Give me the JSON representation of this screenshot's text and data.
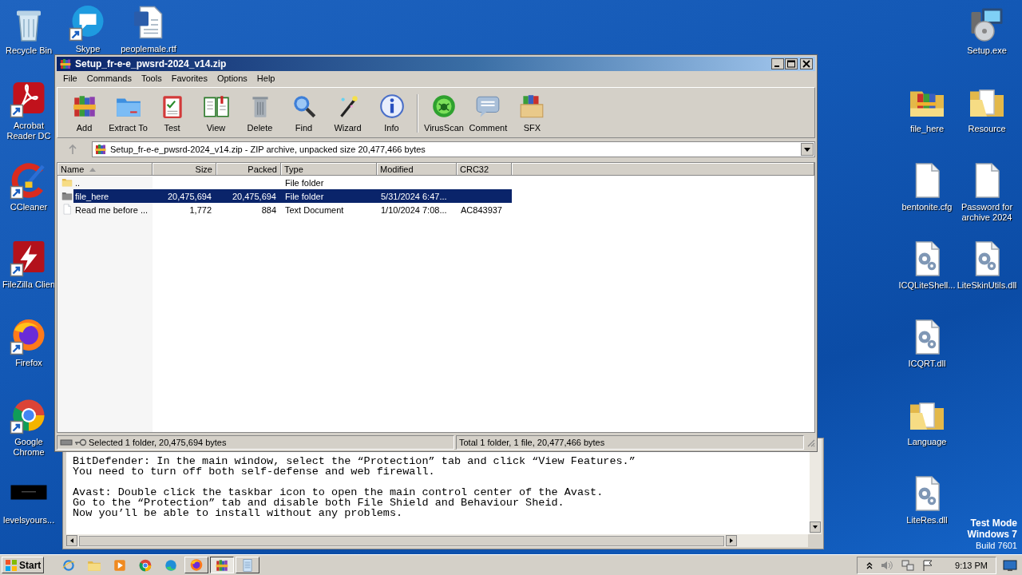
{
  "desktop": {
    "left_icons": [
      {
        "label": "Recycle Bin"
      },
      {
        "label": "Acrobat Reader DC"
      },
      {
        "label": "CCleaner"
      },
      {
        "label": "FileZilla Clien"
      },
      {
        "label": "Firefox"
      },
      {
        "label": "Google Chrome"
      },
      {
        "label": "levelsyours..."
      }
    ],
    "top_icons": [
      {
        "label": "Skype"
      },
      {
        "label": "peoplemale.rtf"
      }
    ],
    "right_icons": [
      {
        "label": "Setup.exe"
      },
      {
        "label": "file_here"
      },
      {
        "label": "Resource"
      },
      {
        "label": "bentonite.cfg"
      },
      {
        "label": "Password for archive 2024"
      },
      {
        "label": "ICQLiteShell..."
      },
      {
        "label": "LiteSkinUtils.dll"
      },
      {
        "label": "ICQRT.dll"
      },
      {
        "label": "Language"
      },
      {
        "label": "LiteRes.dll"
      }
    ]
  },
  "archive_window": {
    "title": "Setup_fr-e-e_pwsrd-2024_v14.zip",
    "menu": [
      "File",
      "Commands",
      "Tools",
      "Favorites",
      "Options",
      "Help"
    ],
    "toolbar": [
      {
        "label": "Add"
      },
      {
        "label": "Extract To"
      },
      {
        "label": "Test"
      },
      {
        "label": "View"
      },
      {
        "label": "Delete"
      },
      {
        "label": "Find"
      },
      {
        "label": "Wizard"
      },
      {
        "label": "Info"
      },
      {
        "label": "VirusScan"
      },
      {
        "label": "Comment"
      },
      {
        "label": "SFX"
      }
    ],
    "address": "Setup_fr-e-e_pwsrd-2024_v14.zip - ZIP archive, unpacked size 20,477,466 bytes",
    "columns": [
      "Name",
      "Size",
      "Packed",
      "Type",
      "Modified",
      "CRC32"
    ],
    "rows": [
      {
        "cells": [
          "..",
          "",
          "",
          "File folder",
          "",
          ""
        ],
        "selected": false
      },
      {
        "cells": [
          "file_here",
          "20,475,694",
          "20,475,694",
          "File folder",
          "5/31/2024 6:47...",
          ""
        ],
        "selected": true
      },
      {
        "cells": [
          "Read me before ...",
          "1,772",
          "884",
          "Text Document",
          "1/10/2024 7:08...",
          "AC843937"
        ],
        "selected": false
      }
    ],
    "status_left": "Selected 1 folder, 20,475,694 bytes",
    "status_right": "Total 1 folder, 1 file, 20,477,466 bytes"
  },
  "text_window": {
    "paragraphs": [
      {
        "lines": [
          "BitDefender: In the main window, select the “Protection” tab and click “View Features.”",
          "You need to turn off both self-defense and web firewall."
        ]
      },
      {
        "lines": [
          "Avast: Double click the taskbar icon to open the main control center of the Avast.",
          "Go to the “Protection” tab and disable both File Shield and Behaviour Sheid.",
          "Now you’ll be able to install without any problems."
        ]
      }
    ]
  },
  "system_notice": [
    "Test Mode",
    "Windows 7",
    "Build 7601"
  ],
  "taskbar": {
    "start": "Start",
    "apps": [
      {
        "running": false,
        "selected": false
      },
      {
        "running": false,
        "selected": false
      },
      {
        "running": false,
        "selected": false
      },
      {
        "running": false,
        "selected": false
      },
      {
        "running": false,
        "selected": false
      },
      {
        "running": true,
        "selected": false
      },
      {
        "running": true,
        "selected": true
      },
      {
        "running": true,
        "selected": false
      }
    ],
    "clock": "9:13 PM"
  }
}
